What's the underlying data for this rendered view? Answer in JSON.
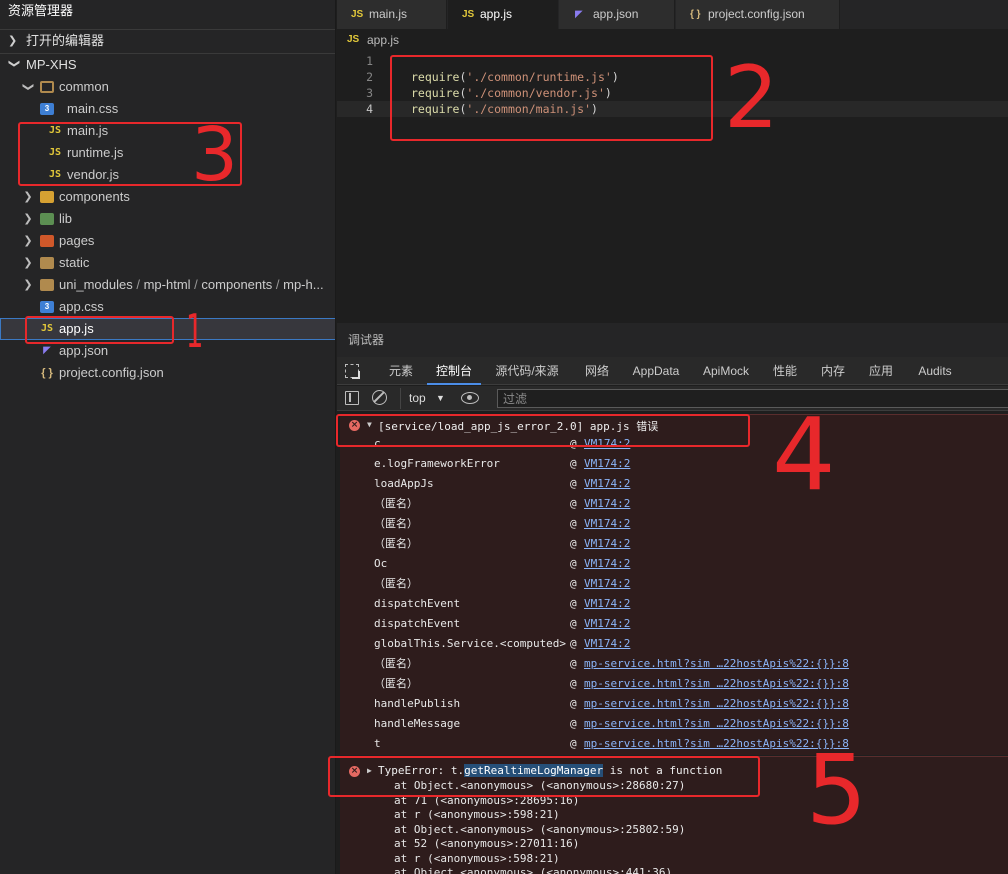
{
  "sidebar": {
    "title": "资源管理器",
    "sections": {
      "open_editors": "打开的编辑器",
      "project": "MP-XHS"
    },
    "tree": {
      "common": {
        "label": "common",
        "children": [
          "main.css",
          "main.js",
          "runtime.js",
          "vendor.js"
        ]
      },
      "components": "components",
      "lib": "lib",
      "pages": "pages",
      "static": "static",
      "uni_modules": {
        "path": [
          "uni_modules",
          "mp-html",
          "components",
          "mp-h..."
        ],
        "separator": "/"
      },
      "root_files": [
        "app.css",
        "app.js",
        "app.json",
        "project.config.json"
      ],
      "selected": "app.js"
    }
  },
  "editor": {
    "tabs": [
      {
        "icon": "JS",
        "label": "main.js"
      },
      {
        "icon": "JS",
        "label": "app.js"
      },
      {
        "icon": "◤",
        "label": "app.json"
      },
      {
        "icon": "{ }",
        "label": "project.config.json"
      }
    ],
    "active_tab": "app.js",
    "breadcrumb": {
      "icon": "JS",
      "label": "app.js"
    },
    "lines": [
      {
        "num": "1",
        "fn": "",
        "open": "",
        "str": "",
        "close": ""
      },
      {
        "num": "2",
        "fn": "require",
        "open": "(",
        "str": "'./common/runtime.js'",
        "close": ")"
      },
      {
        "num": "3",
        "fn": "require",
        "open": "(",
        "str": "'./common/vendor.js'",
        "close": ")"
      },
      {
        "num": "4",
        "fn": "require",
        "open": "(",
        "str": "'./common/main.js'",
        "close": ")"
      }
    ],
    "current_line": "4"
  },
  "debugger": {
    "title": "调试器",
    "tabs": [
      "元素",
      "控制台",
      "源代码/来源",
      "网络",
      "AppData",
      "ApiMock",
      "性能",
      "内存",
      "应用",
      "Audits"
    ],
    "active_tab": "控制台",
    "context": "top",
    "filter_placeholder": "过滤",
    "error1": {
      "message": "[service/load_app_js_error_2.0] app.js 错误",
      "stack": [
        {
          "fn": "c",
          "at": "@",
          "src": "VM174:2"
        },
        {
          "fn": "e.logFrameworkError",
          "at": "@",
          "src": "VM174:2"
        },
        {
          "fn": "loadAppJs",
          "at": "@",
          "src": "VM174:2"
        },
        {
          "fn": "（匿名）",
          "at": "@",
          "src": "VM174:2"
        },
        {
          "fn": "（匿名）",
          "at": "@",
          "src": "VM174:2"
        },
        {
          "fn": "（匿名）",
          "at": "@",
          "src": "VM174:2"
        },
        {
          "fn": "Oc",
          "at": "@",
          "src": "VM174:2"
        },
        {
          "fn": "（匿名）",
          "at": "@",
          "src": "VM174:2"
        },
        {
          "fn": "dispatchEvent",
          "at": "@",
          "src": "VM174:2"
        },
        {
          "fn": "dispatchEvent",
          "at": "@",
          "src": "VM174:2"
        },
        {
          "fn": "globalThis.Service.<computed>",
          "at": "@",
          "src": "VM174:2"
        },
        {
          "fn": "（匿名）",
          "at": "@",
          "src": "mp-service.html?sim …22hostApis%22:{}}:8"
        },
        {
          "fn": "（匿名）",
          "at": "@",
          "src": "mp-service.html?sim …22hostApis%22:{}}:8"
        },
        {
          "fn": "handlePublish",
          "at": "@",
          "src": "mp-service.html?sim …22hostApis%22:{}}:8"
        },
        {
          "fn": "handleMessage",
          "at": "@",
          "src": "mp-service.html?sim …22hostApis%22:{}}:8"
        },
        {
          "fn": "t",
          "at": "@",
          "src": "mp-service.html?sim …22hostApis%22:{}}:8"
        }
      ]
    },
    "error2": {
      "prefix": "TypeError: t.",
      "highlight": "getRealtimeLogManager",
      "suffix": " is not a function",
      "trace": [
        "at Object.<anonymous> (<anonymous>:28680:27)",
        "at 71 (<anonymous>:28695:16)",
        "at r (<anonymous>:598:21)",
        "at Object.<anonymous> (<anonymous>:25802:59)",
        "at 52 (<anonymous>:27011:16)",
        "at r (<anonymous>:598:21)",
        "at Object.<anonymous> (<anonymous>:441:36)"
      ]
    }
  },
  "annotations": [
    "1",
    "2",
    "3",
    "4",
    "5"
  ],
  "colors": {
    "annotation": "#e8282b",
    "js_icon": "#e2c83a",
    "css_icon": "#3e7fd4",
    "link": "#8ab4f8",
    "error_icon": "#e46962"
  }
}
